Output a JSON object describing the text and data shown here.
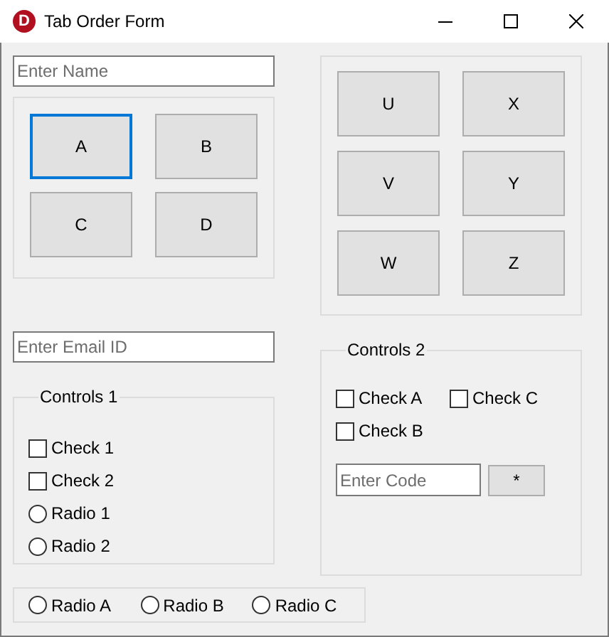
{
  "window": {
    "title": "Tab Order Form",
    "icon_letter": "D"
  },
  "name_field": {
    "placeholder": "Enter Name"
  },
  "panel_1": {
    "buttons": [
      {
        "label": "A",
        "focused": true
      },
      {
        "label": "B",
        "focused": false
      },
      {
        "label": "C",
        "focused": false
      },
      {
        "label": "D",
        "focused": false
      }
    ]
  },
  "panel_2": {
    "buttons": [
      {
        "label": "U",
        "focused": false
      },
      {
        "label": "X",
        "focused": false
      },
      {
        "label": "V",
        "focused": false
      },
      {
        "label": "Y",
        "focused": false
      },
      {
        "label": "W",
        "focused": false
      },
      {
        "label": "Z",
        "focused": false
      }
    ]
  },
  "email_field": {
    "placeholder": "Enter Email ID"
  },
  "controls_1": {
    "title": "Controls 1",
    "items": [
      {
        "kind": "checkbox",
        "label": "Check 1",
        "checked": false
      },
      {
        "kind": "checkbox",
        "label": "Check 2",
        "checked": false
      },
      {
        "kind": "radio",
        "label": "Radio 1",
        "selected": false
      },
      {
        "kind": "radio",
        "label": "Radio 2",
        "selected": false
      }
    ]
  },
  "controls_2": {
    "title": "Controls 2",
    "checkboxes": [
      {
        "label": "Check A",
        "checked": false
      },
      {
        "label": "Check C",
        "checked": false
      },
      {
        "label": "Check B",
        "checked": false
      }
    ],
    "code_field": {
      "placeholder": "Enter Code"
    },
    "button": "*"
  },
  "bottom_radios": [
    {
      "label": "Radio A",
      "selected": false
    },
    {
      "label": "Radio B",
      "selected": false
    },
    {
      "label": "Radio C",
      "selected": false
    }
  ]
}
